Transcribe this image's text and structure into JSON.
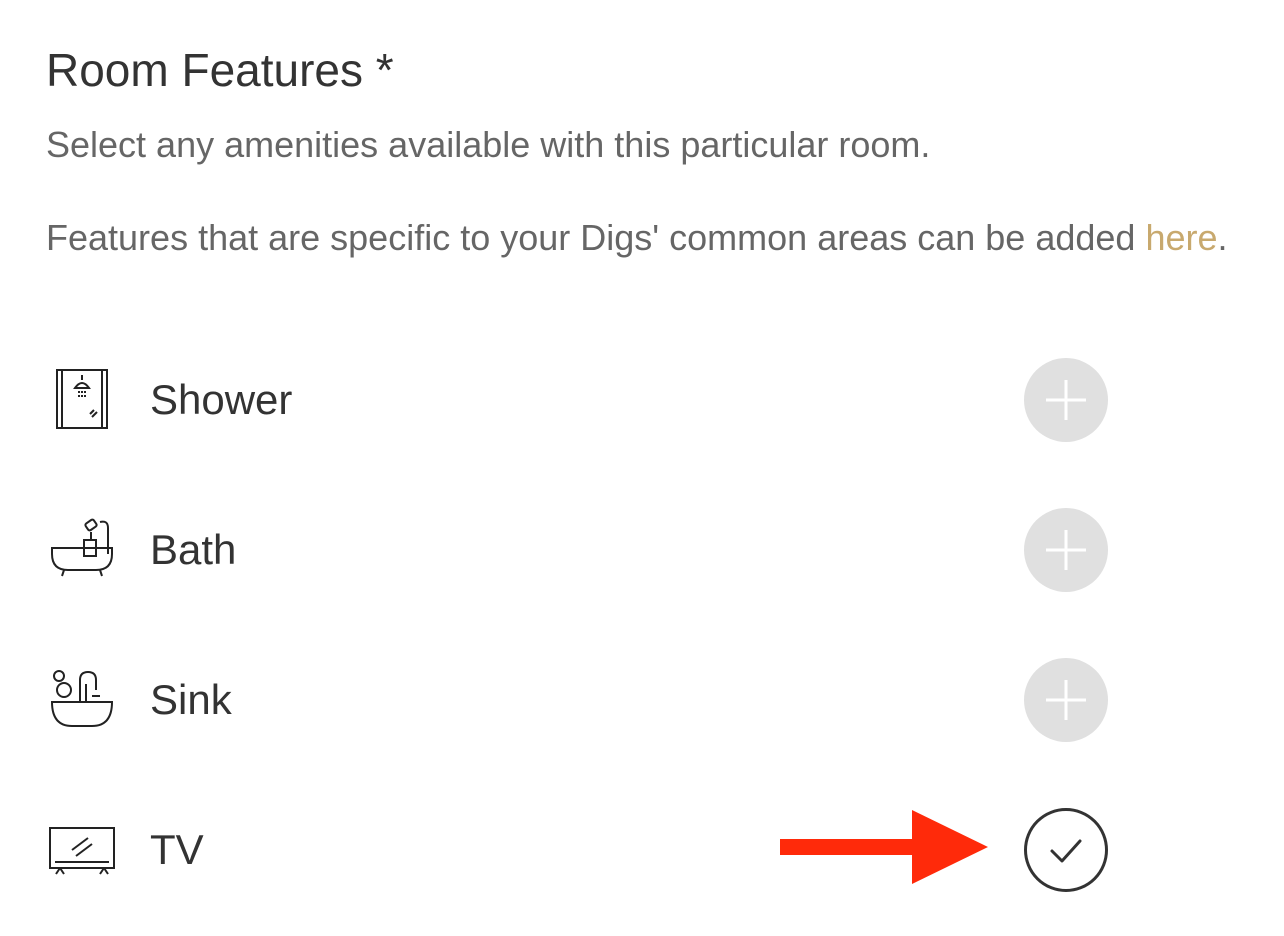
{
  "header": {
    "title": "Room Features *",
    "description": "Select any amenities available with this particular room.",
    "common_areas_text": "Features that are specific to your Digs' common areas can be added ",
    "common_areas_link": "here",
    "common_areas_end": "."
  },
  "features": [
    {
      "label": "Shower",
      "icon": "shower-icon",
      "selected": false
    },
    {
      "label": "Bath",
      "icon": "bathtub-icon",
      "selected": false
    },
    {
      "label": "Sink",
      "icon": "sink-icon",
      "selected": false
    },
    {
      "label": "TV",
      "icon": "tv-icon",
      "selected": true
    }
  ],
  "colors": {
    "link": "#c8a96e",
    "toggle_off": "#e0e0e0",
    "toggle_on_border": "#333333",
    "annotation_arrow": "#ff2a0a"
  }
}
